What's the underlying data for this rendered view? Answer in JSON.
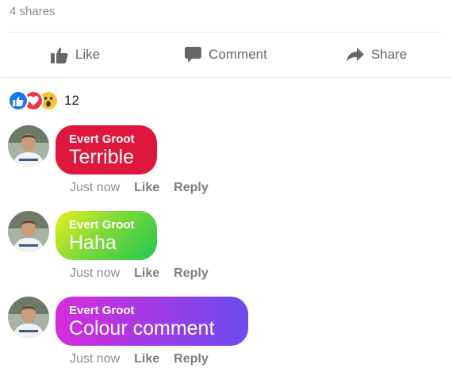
{
  "post": {
    "shares_text": "4 shares"
  },
  "actions": {
    "like_label": "Like",
    "comment_label": "Comment",
    "share_label": "Share"
  },
  "reactions": {
    "types": [
      "like",
      "love",
      "wow"
    ],
    "count": "12"
  },
  "comments": [
    {
      "author": "Evert Groot",
      "text": "Terrible",
      "time": "Just now",
      "like_label": "Like",
      "reply_label": "Reply",
      "bubble_color": "#e0173d"
    },
    {
      "author": "Evert Groot",
      "text": "Haha",
      "time": "Just now",
      "like_label": "Like",
      "reply_label": "Reply",
      "bubble_color": "green-yellow gradient"
    },
    {
      "author": "Evert Groot",
      "text": "Colour comment",
      "time": "Just now",
      "like_label": "Like",
      "reply_label": "Reply",
      "bubble_color": "purple gradient"
    }
  ],
  "colors": {
    "action_gray": "#65676b",
    "like_blue": "#1877f2",
    "love_red": "#f0344a",
    "wow_yellow": "#f7c531"
  }
}
